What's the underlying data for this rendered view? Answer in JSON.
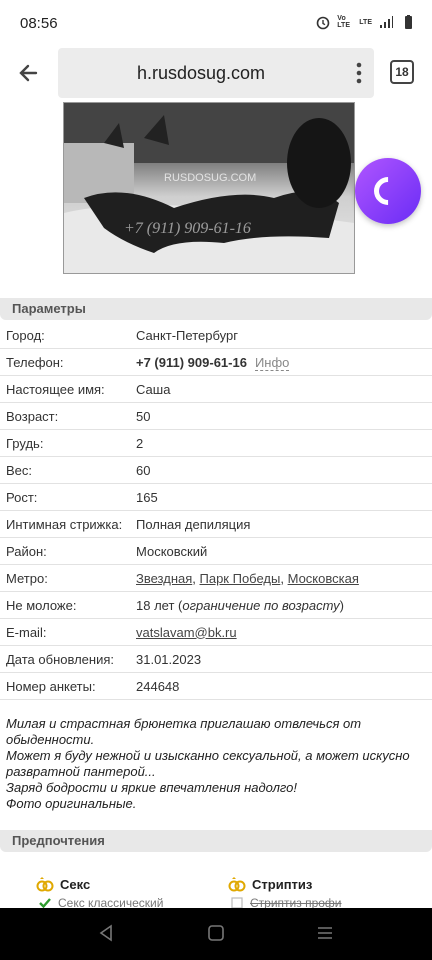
{
  "status": {
    "time": "08:56",
    "icons": [
      "alarm-icon",
      "volte-icon",
      "lte-icon",
      "signal-icon",
      "battery-icon"
    ],
    "volte_label": "Vo LTE",
    "lte_label": "LTE"
  },
  "browser": {
    "url": "h.rusdosug.com",
    "tab_count": "18"
  },
  "params": {
    "title": "Параметры",
    "rows": [
      {
        "key": "Город:",
        "value": "Санкт-Петербург"
      },
      {
        "key": "Телефон:",
        "value": "+7 (911) 909-61-16",
        "extra": "Инфо"
      },
      {
        "key": "Настоящее имя:",
        "value": "Саша"
      },
      {
        "key": "Возраст:",
        "value": "50"
      },
      {
        "key": "Грудь:",
        "value": "2"
      },
      {
        "key": "Вес:",
        "value": "60"
      },
      {
        "key": "Рост:",
        "value": "165"
      },
      {
        "key": "Интимная стрижка:",
        "value": "Полная депиляция"
      },
      {
        "key": "Район:",
        "value": "Московский"
      },
      {
        "key": "Метро:",
        "links": [
          "Звездная",
          "Парк Победы",
          "Московская"
        ],
        "sep": ", "
      },
      {
        "key": "Не моложе:",
        "value": "18 лет (",
        "value_italic": "ограничение по возрасту",
        "value_end": ")"
      },
      {
        "key": "E-mail:",
        "value": "vatslavam@bk.ru"
      },
      {
        "key": "Дата обновления:",
        "value": "31.01.2023"
      },
      {
        "key": "Номер анкеты:",
        "value": "244648"
      }
    ]
  },
  "description": {
    "lines": [
      "Милая и страстная брюнетка приглашаю отвлечься от обыденности.",
      "Может я буду нежной и изысканно сексуальной, а может искусно развратной пантерой...",
      "Заряд бодрости и яркие впечатления надолго!",
      "Фото оригинальные."
    ]
  },
  "preferences": {
    "title": "Предпочтения",
    "columns": [
      {
        "header": "Секс",
        "item": "Секс классический",
        "item_checked": true
      },
      {
        "header": "Стриптиз",
        "item": "Стриптиз профи",
        "item_checked": false
      }
    ]
  },
  "photo": {
    "watermark": "RUSDOSUG.COM",
    "phone_overlay": "+7 (911) 909-61-16"
  },
  "colors": {
    "alice_purple": "#8a3cff",
    "section_bg": "#e8e8e8"
  }
}
